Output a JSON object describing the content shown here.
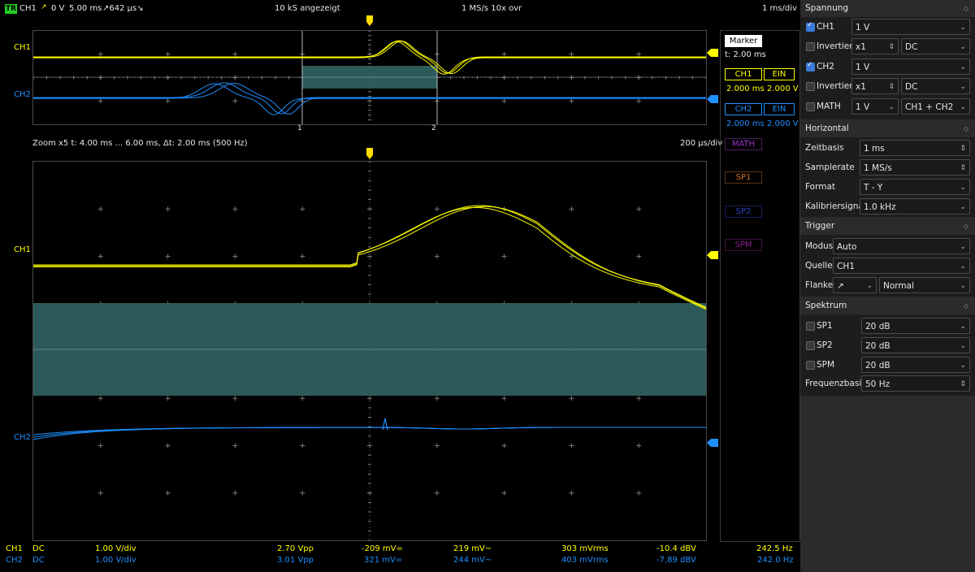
{
  "status": {
    "badge": "TR",
    "ch": "CH1",
    "slope_icon": "rising-edge-icon",
    "trig_level": "0 V",
    "time": "5.00 ms",
    "pretrig": "↗642 µs↘",
    "samples": "10 kS angezeigt",
    "rate": "1 MS/s 10x ovr",
    "timebase": "1 ms/div"
  },
  "overview": {
    "ch1_label": "CH1",
    "ch2_label": "CH2",
    "cursor1": "1",
    "cursor2": "2"
  },
  "zoom": {
    "info": "Zoom x5   t: 4.00 ms ... 6.00 ms,  Δt: 2.00 ms (500 Hz)",
    "div": "200 µs/div",
    "ch1_label": "CH1",
    "ch2_label": "CH2"
  },
  "marker": {
    "title": "Marker",
    "t": "t: 2.00 ms",
    "ch1": "CH1",
    "ch1_state": "EIN",
    "ch1_values": "2.000 ms 2.000 V",
    "ch2": "CH2",
    "ch2_state": "EIN",
    "ch2_values": "2.000 ms 2.000 V",
    "math": "MATH",
    "sp1": "SP1",
    "sp2": "SP2",
    "spm": "SPM"
  },
  "colors": {
    "ch1": "#ffff00",
    "ch2": "#1e90ff",
    "math": "#9b30c8",
    "sp1": "#d07020",
    "sp2": "#2a40c0",
    "spm": "#8a2090",
    "marker_fill": "#2e5f5f"
  },
  "panel": {
    "spannung": {
      "title": "Spannung",
      "ch1_label": "CH1",
      "ch1_value": "1 V",
      "invert1_label": "Invertiert",
      "invert1_probe": "x1",
      "invert1_coupling": "DC",
      "ch2_label": "CH2",
      "ch2_value": "1 V",
      "invert2_label": "Invertiert",
      "invert2_probe": "x1",
      "invert2_coupling": "DC",
      "math_label": "MATH",
      "math_value": "1 V",
      "math_mode": "CH1 + CH2"
    },
    "horizontal": {
      "title": "Horizontal",
      "zeitbasis_label": "Zeitbasis",
      "zeitbasis_value": "1 ms",
      "samplerate_label": "Samplerate",
      "samplerate_value": "1 MS/s",
      "format_label": "Format",
      "format_value": "T - Y",
      "kalib_label": "Kalibriersignal",
      "kalib_value": "1.0 kHz"
    },
    "trigger": {
      "title": "Trigger",
      "modus_label": "Modus",
      "modus_value": "Auto",
      "quelle_label": "Quelle",
      "quelle_value": "CH1",
      "flanke_label": "Flanke",
      "flanke_value": "↗",
      "flanke_mode": "Normal"
    },
    "spektrum": {
      "title": "Spektrum",
      "sp1_label": "SP1",
      "sp1_value": "20 dB",
      "sp2_label": "SP2",
      "sp2_value": "20 dB",
      "spm_label": "SPM",
      "spm_value": "20 dB",
      "freq_label": "Frequenzbasis",
      "freq_value": "50 Hz"
    }
  },
  "measure": {
    "ch1": {
      "name": "CH1",
      "coupling": "DC",
      "vdiv": "1.00 V/div",
      "vpp": "2.70 Vpp",
      "dc": "-209 mV=",
      "ac": "219 mV~",
      "rms": "303 mVrms",
      "dbv": "-10.4 dBV",
      "freq": "242.5 Hz"
    },
    "ch2": {
      "name": "CH2",
      "coupling": "DC",
      "vdiv": "1.00 V/div",
      "vpp": "3.01 Vpp",
      "dc": "321 mV=",
      "ac": "244 mV~",
      "rms": "403 mVrms",
      "dbv": "-7.89 dBV",
      "freq": "242.0 Hz"
    }
  }
}
